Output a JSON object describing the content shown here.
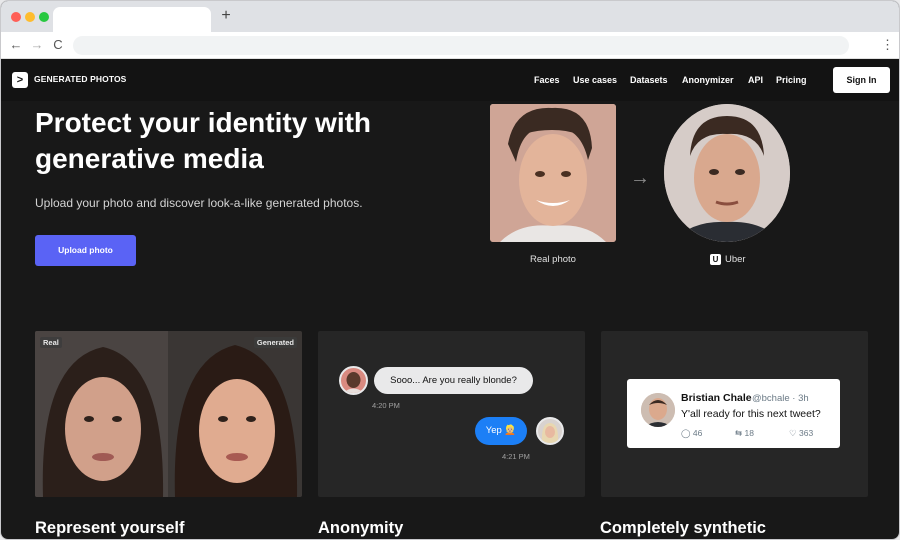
{
  "browser": {
    "new_tab": "+",
    "back": "←",
    "forward": "→",
    "reload": "C",
    "menu": "⋮"
  },
  "header": {
    "logo_glyph": ">",
    "logo_text": "GENERATED PHOTOS",
    "nav": [
      "Faces",
      "Use cases",
      "Datasets",
      "Anonymizer",
      "API",
      "Pricing"
    ],
    "sign_in": "Sign In"
  },
  "hero": {
    "title_line1": "Protect your identity with",
    "title_line2": "generative media",
    "subtitle": "Upload your photo and discover look-a-like generated photos.",
    "upload_button": "Upload photo",
    "real_caption": "Real photo",
    "gen_caption": "Uber",
    "uber_glyph": "U"
  },
  "cards": [
    {
      "title": "Represent yourself",
      "tag_real": "Real",
      "tag_generated": "Generated"
    },
    {
      "title": "Anonymity",
      "message_in": "Sooo... Are you really blonde?",
      "time_in": "4:20 PM",
      "message_out": "Yep 👱🏼",
      "time_out": "4:21 PM"
    },
    {
      "title": "Completely synthetic",
      "tweet": {
        "name": "Bristian Chale",
        "handle": "@bchale · 3h",
        "text": "Y'all ready for this next tweet?",
        "replies": "46",
        "retweets": "18",
        "likes": "363"
      }
    }
  ],
  "colors": {
    "accent": "#5a63f5",
    "background": "#181818",
    "card": "#262626",
    "bubble_out": "#1c7ff6"
  }
}
